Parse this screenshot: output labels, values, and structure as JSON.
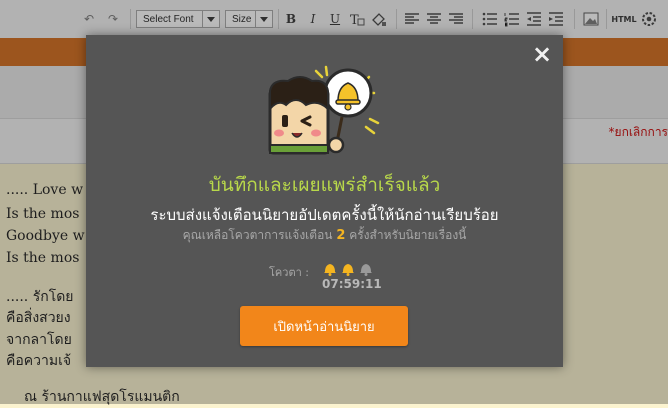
{
  "toolbar": {
    "font_select": "Select Font",
    "size_select": "Size",
    "undo_glyph": "↶",
    "redo_glyph": "↷",
    "bold_glyph": "B",
    "italic_glyph": "I",
    "underline_glyph": "U",
    "html_label": "HTML"
  },
  "page": {
    "cancel_link": "*ยกเลิกการ",
    "content_lines": [
      "..... Love w",
      "Is the mos",
      "Goodbye w",
      "Is the mos",
      "..... รักโดย",
      "คือสิ่งสวยง",
      "จากลาโดย",
      "คือความเจ้",
      "ณ ร้านกาแฟสุดโรแมนติก"
    ]
  },
  "modal": {
    "close_glyph": "×",
    "title": "บันทึกและเผยแพร่สำเร็จแล้ว",
    "subtitle": "ระบบส่งแจ้งเตือนนิยายอัปเดตครั้งนี้ให้นักอ่านเรียบร้อย",
    "quota_prefix": "คุณเหลือโควตาการแจ้งเตือน",
    "quota_count": "2",
    "quota_suffix": "ครั้งสำหรับนิยายเรื่องนี้",
    "quota_label": "โควตา :",
    "quota_used": 2,
    "quota_total": 3,
    "timer": "07:59:11",
    "open_button": "เปิดหน้าอ่านนิยาย"
  },
  "colors": {
    "accent_orange": "#f2861a",
    "title_green": "#b8d84a",
    "bell_active": "#f5b520",
    "bell_inactive": "#9a9a9a"
  }
}
